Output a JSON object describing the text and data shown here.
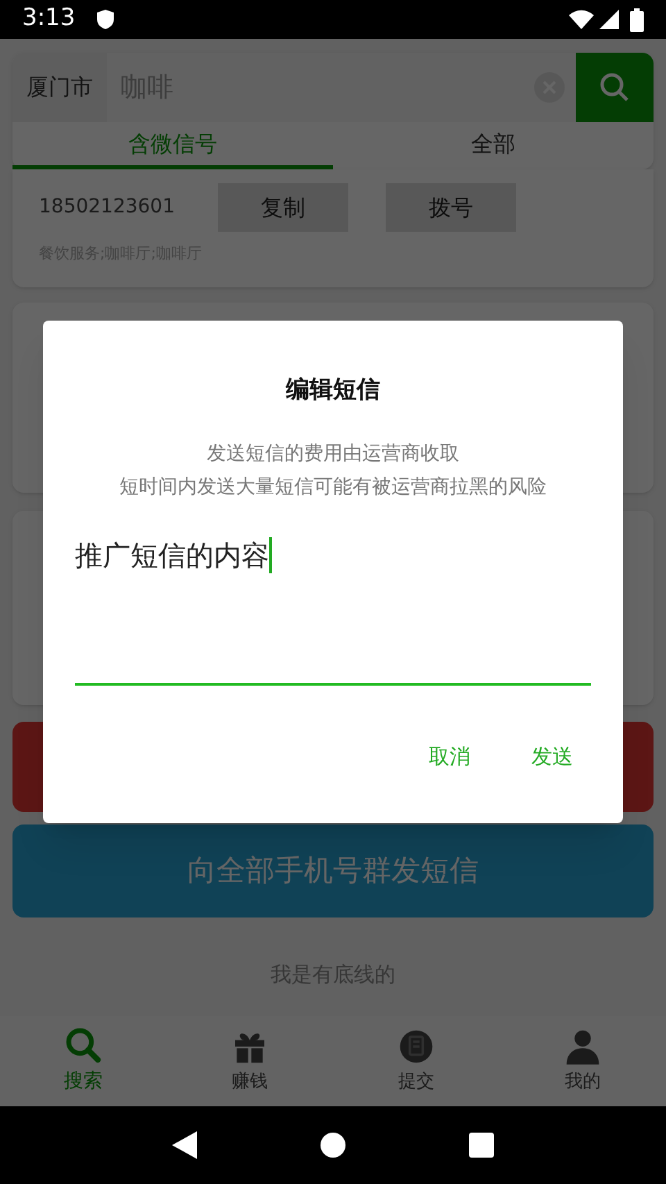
{
  "status_bar": {
    "time": "3:13"
  },
  "search": {
    "city": "厦门市",
    "query": "咖啡"
  },
  "tabs": [
    {
      "label": "含微信号",
      "selected": true
    },
    {
      "label": "全部",
      "selected": false
    }
  ],
  "result": {
    "phone": "18502123601",
    "copy_button": "复制",
    "dial_button": "拨号",
    "tags": "餐饮服务;咖啡厅;咖啡厅"
  },
  "bulk_sms_button": "向全部手机号群发短信",
  "footer_text": "我是有底线的",
  "bottom_nav": [
    {
      "label": "搜索",
      "kind": "search",
      "selected": true
    },
    {
      "label": "赚钱",
      "kind": "gift",
      "selected": false
    },
    {
      "label": "提交",
      "kind": "doc",
      "selected": false
    },
    {
      "label": "我的",
      "kind": "person",
      "selected": false
    }
  ],
  "dialog": {
    "title": "编辑短信",
    "notice": [
      "发送短信的费用由运营商收取",
      "短时间内发送大量短信可能有被运营商拉黑的风险"
    ],
    "message": "推广短信的内容",
    "cancel": "取消",
    "send": "发送"
  }
}
